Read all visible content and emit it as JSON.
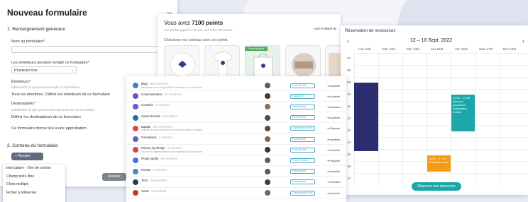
{
  "form": {
    "title": "Nouveau formulaire",
    "close_icon": "close-icon",
    "section1": "1. Renseignement généraux",
    "name_label": "Nom du formulaire*",
    "emitters_label": "Les émetteurs peuvent remplir ce formulaire*",
    "emitters_value": "Plusieurs fois",
    "emitteurs_heading": "Émetteurs*",
    "emitteurs_help": "Définissez ici qui pourra remplir ce formulaire.",
    "emitteurs_value": "Tous les membres. Définir les émetteurs de ce formulaire",
    "dest_heading": "Destinataires*",
    "dest_help": "Définissez ici qui recevra les réponses de ce formulaire.",
    "dest_value": "Définir les destinataires de ce formulaire",
    "approval_text": "Ce formulaire donne lieu à une approbation",
    "section2": "2. Contenu du formulaire",
    "add_button": "+ Ajouter",
    "menu_items": [
      "Intercalaire - Titre de section",
      "Champ texte libre",
      "Choix multiple",
      "Fichier à téléverser"
    ],
    "cancel_button": "Annuler"
  },
  "rewards": {
    "title_prefix": "Vous avez ",
    "points": "7100 points",
    "subtitle": "Vos points gagnés à la une. Vos infos découvrez",
    "choose_text": "Choisissez vos cadeaux avec vos points",
    "details_link": "Voir le détail de",
    "ribbon": "Favoris/Avez"
  },
  "communities": [
    {
      "name": "Blog",
      "members": "250 membres",
      "sub": "Bienvenue sur le blog AGME, Une vitrine pour vos idées",
      "badge": "Code d'ICAM",
      "action": "Accéder",
      "color": "#3b82c4"
    },
    {
      "name": "Communication",
      "members": "93 membres",
      "sub": "",
      "badge": "Pagination",
      "action": "Accéder",
      "color": "#7c4dbf"
    },
    {
      "name": "Conseils",
      "members": "2 membres",
      "sub": "",
      "badge": "Personnalisé",
      "action": "Demand",
      "color": "#6a5acd"
    },
    {
      "name": "Cybersécurité",
      "members": "3 membres",
      "sub": "",
      "badge": "Personnalisé",
      "action": "Accéder",
      "color": "#2b6ca3"
    },
    {
      "name": "Equipe",
      "members": "240 membres",
      "sub": "Espace de communication et d'échanges dédié à l'équipe",
      "badge": "Organisation AGME",
      "action": "Rejoindr",
      "color": "#e04848"
    },
    {
      "name": "Formations",
      "members": "1 membre",
      "sub": "",
      "badge": "Personnalisé",
      "action": "Accéder",
      "color": "#5b5fc7"
    },
    {
      "name": "Privacy by design",
      "members": "3 membres",
      "sub": "Tout sur la réglementation et la protection de la vie privée",
      "badge": "Code d'ICAM",
      "action": "Accéder",
      "color": "#d64545"
    },
    {
      "name": "Projet Apollo",
      "members": "46 membres",
      "sub": "",
      "badge": "Projet à l'Annee",
      "action": "Rejoindr",
      "color": "#3a7bd5"
    },
    {
      "name": "Presse",
      "members": "1 membre",
      "sub": "",
      "badge": "Personnalisé",
      "action": "Accéder",
      "color": "#4b8bbe"
    },
    {
      "name": "Tech",
      "members": "29 membres",
      "sub": "",
      "badge": "Personnalisé",
      "action": "Demand",
      "color": "#2c3e50"
    },
    {
      "name": "Vente",
      "members": "2 membres",
      "sub": "",
      "badge": "Organisation AGME",
      "action": "Accéder",
      "color": "#c0392b"
    }
  ],
  "calendar": {
    "title": "Réservation de ressources",
    "range": "12 – 18 Sept. 2022",
    "days": [
      "Lun 12/9",
      "Mar 13/9",
      "Mer 14/9",
      "Jeu 15/9",
      "Ven 16/9",
      "Sam 17/9",
      "Dim 18/9"
    ],
    "hours": [
      "07",
      "08",
      "09",
      "10",
      "11",
      "12",
      "13",
      "14",
      "15",
      "16",
      "17"
    ],
    "event_green_time": "11:30 – 14:30",
    "event_green_title": "Réunion personnel Application mobile",
    "event_orange_time": "16:00 – 17:30",
    "event_orange_title": "Projection vidéo",
    "reserve_button": "Réserver une ressource",
    "colors": {
      "navy": "#2b2d6e",
      "teal": "#1ba7a9",
      "orange": "#f39c12"
    }
  }
}
